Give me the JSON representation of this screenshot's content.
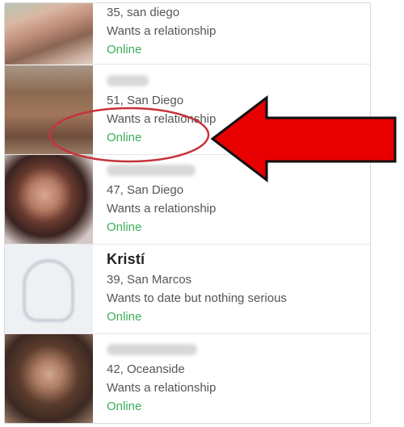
{
  "profiles": [
    {
      "name": "",
      "age_location": "35, san diego",
      "intent": "Wants a relationship",
      "status": "Online"
    },
    {
      "name": "",
      "age_location": "51, San Diego",
      "intent": "Wants a relationship",
      "status": "Online"
    },
    {
      "name": "",
      "age_location": "47, San Diego",
      "intent": "Wants a relationship",
      "status": "Online"
    },
    {
      "name": "Kristí",
      "age_location": "39, San Marcos",
      "intent": "Wants to date but nothing serious",
      "status": "Online"
    },
    {
      "name": "",
      "age_location": "42, Oceanside",
      "intent": "Wants a relationship",
      "status": "Online"
    }
  ],
  "annotation": {
    "arrow_color": "#e80000",
    "circle_color": "#c8323a",
    "target": "Online status of second profile"
  }
}
